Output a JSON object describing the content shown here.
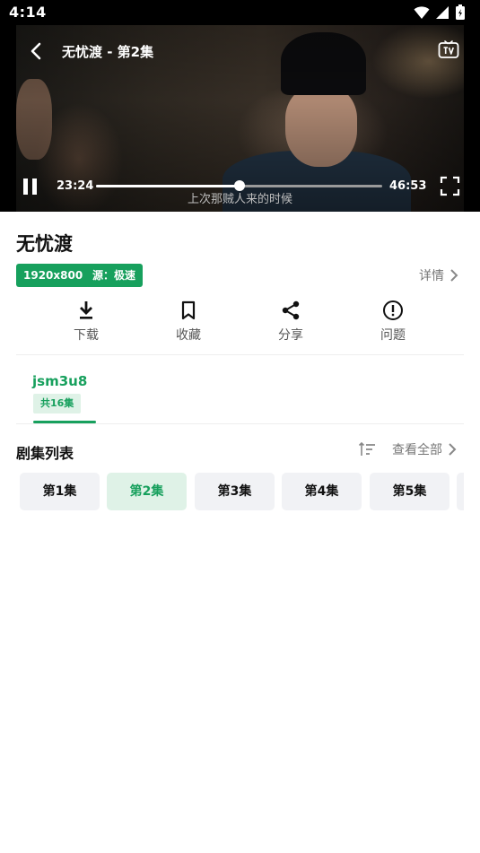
{
  "status_bar": {
    "time": "4:14"
  },
  "player": {
    "title": "无忧渡 - 第2集",
    "current_time": "23:24",
    "duration": "46:53",
    "progress": 0.5,
    "subtitle": "上次那贼人来的时候"
  },
  "show": {
    "title": "无忧渡",
    "tags": [
      "1920x800",
      "源：极速"
    ],
    "detail_label": "详情"
  },
  "actions": [
    {
      "label": "下载",
      "icon": "download-icon"
    },
    {
      "label": "收藏",
      "icon": "bookmark-icon"
    },
    {
      "label": "分享",
      "icon": "share-icon"
    },
    {
      "label": "问题",
      "icon": "alert-icon"
    }
  ],
  "source": {
    "name": "jsm3u8",
    "count": "共16集"
  },
  "episodes_section": {
    "label": "剧集列表",
    "view_all": "查看全部",
    "items": [
      "第1集",
      "第2集",
      "第3集",
      "第4集",
      "第5集"
    ],
    "active_index": 1
  },
  "colors": {
    "accent": "#17a05d",
    "accent_light": "#dff2e7"
  }
}
